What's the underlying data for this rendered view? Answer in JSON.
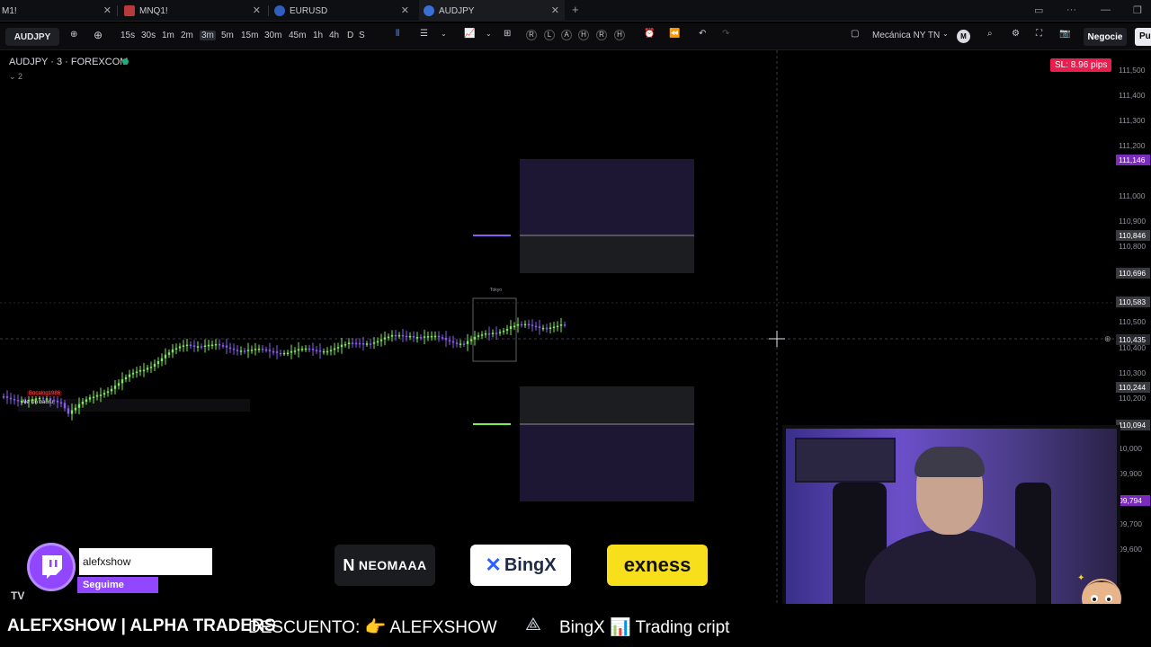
{
  "browser": {
    "tabs": [
      {
        "label": "M1!",
        "active": false
      },
      {
        "label": "MNQ1!",
        "active": false
      },
      {
        "label": "EURUSD",
        "active": false
      },
      {
        "label": "AUDJPY",
        "active": true
      }
    ],
    "new_tab": "+"
  },
  "toolbar": {
    "symbol": "AUDJPY",
    "intervals": [
      "15s",
      "30s",
      "1m",
      "2m",
      "3m",
      "5m",
      "15m",
      "30m",
      "45m",
      "1h",
      "4h",
      "D",
      "S"
    ],
    "selected_interval": "3m",
    "replay_letters": [
      "R",
      "L",
      "A",
      "H",
      "R",
      "H"
    ],
    "layout_name": "Mecánica NY TN",
    "layout_badge": "M",
    "trade_button": "Negocie",
    "publish_button": "Pu"
  },
  "chart": {
    "title": "AUDJPY · 3 · FOREXCOM",
    "collapse_count": "2",
    "sl_badge": "SL: 8.96 pips",
    "session_label": "Tokyo",
    "alert_label": "Ale Un bauru",
    "alert_tag": "Bocalog1986",
    "price_axis_ticks": [
      "111,500",
      "111,400",
      "111,300",
      "111,200",
      "111,000",
      "110,900",
      "110,800",
      "110,500",
      "110,400",
      "110,300",
      "110,200",
      "10,000",
      "09,900",
      "09,700",
      "09,600"
    ],
    "price_tags": [
      {
        "value": "111,146",
        "color": "#7b2cbf"
      },
      {
        "value": "110,846",
        "color": "#3a3b40"
      },
      {
        "value": "110,696",
        "color": "#3a3b40"
      },
      {
        "value": "110,583",
        "color": "#3a3b40"
      },
      {
        "value": "110,435",
        "color": "#2a2b30"
      },
      {
        "value": "110,244",
        "color": "#3a3b40"
      },
      {
        "value": "110,094",
        "color": "#3a3b40"
      },
      {
        "value": "09,794",
        "color": "#7b2cbf"
      }
    ]
  },
  "overlay": {
    "twitch_name": "alefxshow",
    "twitch_follow": "Seguime",
    "sponsors": [
      "NEOMAAA",
      "BingX",
      "exness"
    ],
    "ticker": [
      "ALEFXSHOW | ALPHA TRADERS",
      "DESCUENTO: 👉 ALEFXSHOW",
      "BingX 📊 Trading cript"
    ],
    "watermark": "TV"
  },
  "colors": {
    "up_candle": "#7cf04a",
    "down_candle": "#8b5cf6",
    "zone_purple": "#1f1a33",
    "zone_gray": "#1b1c20",
    "accent_purple": "#9146ff",
    "sl_red": "#e91e4f"
  }
}
